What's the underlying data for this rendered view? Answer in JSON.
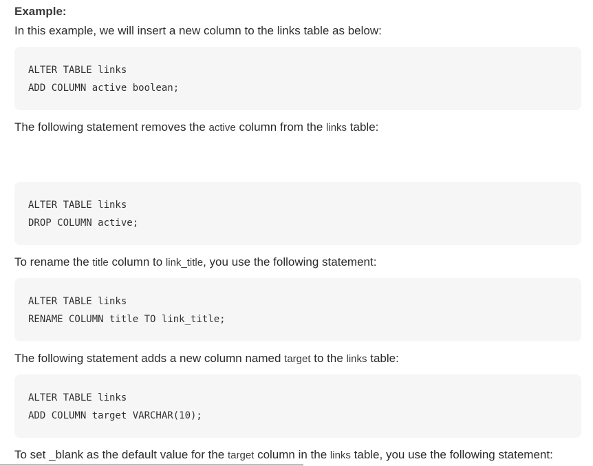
{
  "example_heading": "Example:",
  "intro": "In this example, we will insert a new column to the links table as below:",
  "block1": {
    "line1": "ALTER TABLE links",
    "line2": "ADD COLUMN active boolean;"
  },
  "p2": {
    "a": "The following statement removes the ",
    "code1": "active",
    "b": " column from the ",
    "code2": "links",
    "c": " table:"
  },
  "block2": {
    "line1": "ALTER TABLE links",
    "line2": "DROP COLUMN active;"
  },
  "p3": {
    "a": "To rename the ",
    "code1": "title",
    "b": " column to ",
    "code2": "link_title",
    "c": ", you use the following statement:"
  },
  "block3": {
    "line1": "ALTER TABLE links",
    "line2": "RENAME COLUMN title TO link_title;"
  },
  "p4": {
    "a": "The following statement adds a new column named ",
    "code1": "target",
    "b": " to the ",
    "code2": "links",
    "c": " table:"
  },
  "block4": {
    "line1": "ALTER TABLE links",
    "line2": "ADD COLUMN target VARCHAR(10);"
  },
  "p5": {
    "a": "To set _blank as the default value for the ",
    "code1": "target",
    "b": " column in the ",
    "code2": "links",
    "c": " table, you use the following statement:"
  }
}
